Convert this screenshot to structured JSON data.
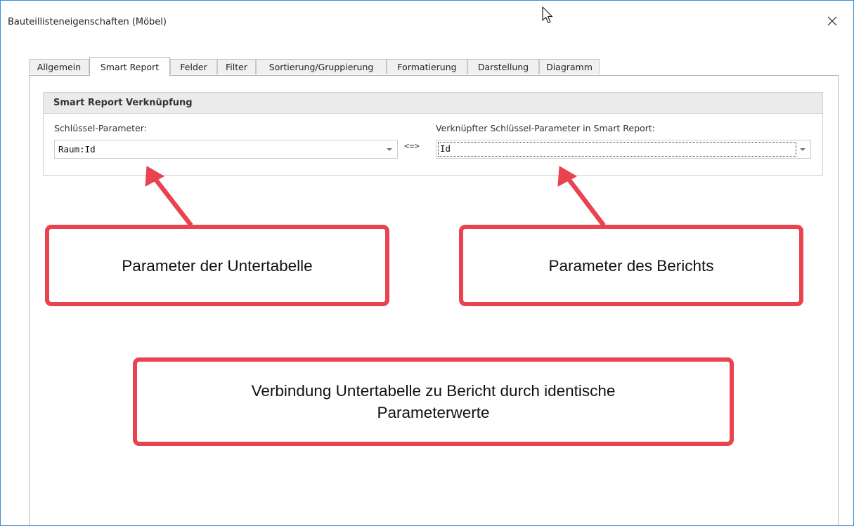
{
  "window": {
    "title": "Bauteillisteneigenschaften (Möbel)"
  },
  "tabs": [
    {
      "label": "Allgemein",
      "active": false
    },
    {
      "label": "Smart Report",
      "active": true
    },
    {
      "label": "Felder",
      "active": false
    },
    {
      "label": "Filter",
      "active": false
    },
    {
      "label": "Sortierung/Gruppierung",
      "active": false
    },
    {
      "label": "Formatierung",
      "active": false
    },
    {
      "label": "Darstellung",
      "active": false
    },
    {
      "label": "Diagramm",
      "active": false
    }
  ],
  "group": {
    "title": "Smart Report Verknüpfung",
    "left_label": "Schlüssel-Parameter:",
    "left_value": "Raum:Id",
    "separator": "<=>",
    "right_label": "Verknüpfter Schlüssel-Parameter in Smart Report:",
    "right_value": "Id"
  },
  "callouts": {
    "left": "Parameter der Untertabelle",
    "right": "Parameter des Berichts",
    "bottom_line1": "Verbindung Untertabelle zu Bericht durch identische",
    "bottom_line2": "Parameterwerte"
  },
  "colors": {
    "callout_border": "#e8434e",
    "window_border": "#3b8fd6"
  }
}
